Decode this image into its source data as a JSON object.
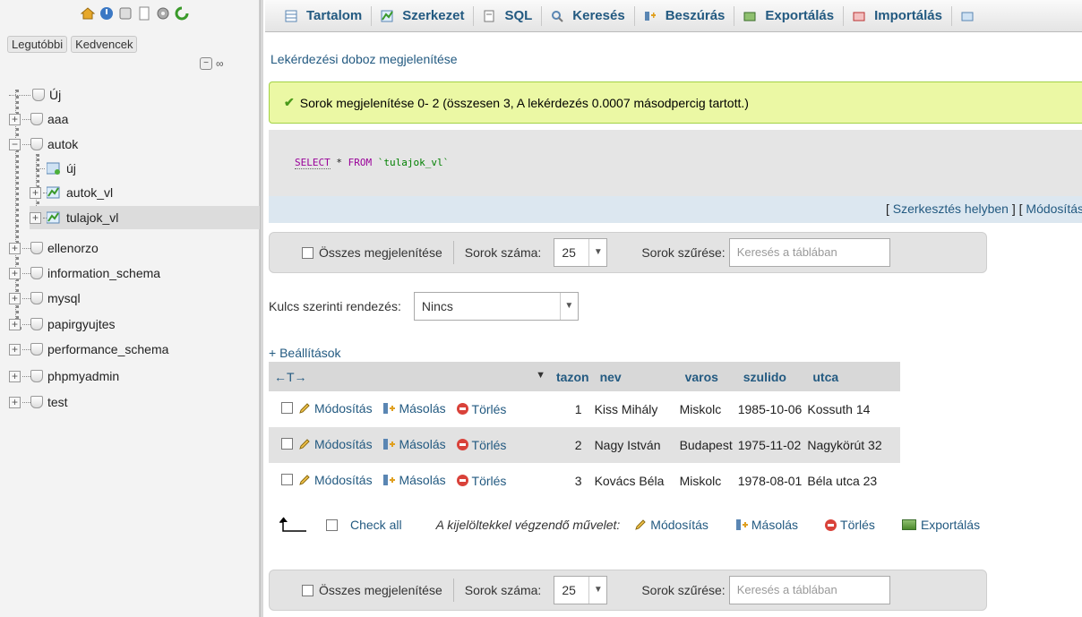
{
  "sidebar": {
    "tabs": [
      "Legutóbbi",
      "Kedvencek"
    ],
    "tree": [
      {
        "label": "Új",
        "kind": "new-db"
      },
      {
        "label": "aaa",
        "kind": "db"
      },
      {
        "label": "autok",
        "kind": "db-open"
      },
      {
        "label": "új",
        "kind": "new-table"
      },
      {
        "label": "autok_vl",
        "kind": "table"
      },
      {
        "label": "tulajok_vl",
        "kind": "table"
      },
      {
        "label": "ellenorzo",
        "kind": "db"
      },
      {
        "label": "information_schema",
        "kind": "db"
      },
      {
        "label": "mysql",
        "kind": "db"
      },
      {
        "label": "papirgyujtes",
        "kind": "db"
      },
      {
        "label": "performance_schema",
        "kind": "db"
      },
      {
        "label": "phpmyadmin",
        "kind": "db"
      },
      {
        "label": "test",
        "kind": "db"
      }
    ]
  },
  "topnav": {
    "tabs": [
      "Tartalom",
      "Szerkezet",
      "SQL",
      "Keresés",
      "Beszúrás",
      "Exportálás",
      "Importálás"
    ]
  },
  "query_box_link": "Lekérdezési doboz megjelenítése",
  "success_message": "Sorok megjelenítése 0- 2 (összesen 3, A lekérdezés 0.0007 másodpercig tartott.)",
  "sql": {
    "kw1": "SELECT",
    "star": " * ",
    "kw2": "FROM",
    "table": " `tulajok_vl`"
  },
  "edit_links": {
    "inline": "Szerkesztés helyben",
    "modify": "Módosítás"
  },
  "navbar": {
    "show_all": "Összes megjelenítése",
    "rows_label": "Sorok száma:",
    "rows_value": "25",
    "filter_label": "Sorok szűrése:",
    "filter_placeholder": "Keresés a táblában"
  },
  "sort": {
    "label": "Kulcs szerinti rendezés:",
    "value": "Nincs"
  },
  "options_link": "+ Beállítások",
  "table": {
    "arrows": "←T→",
    "columns": [
      "tazon",
      "nev",
      "varos",
      "szulido",
      "utca"
    ],
    "actions": {
      "edit": "Módosítás",
      "copy": "Másolás",
      "delete": "Törlés"
    },
    "rows": [
      [
        "1",
        "Kiss Mihály",
        "Miskolc",
        "1985-10-06",
        "Kossuth 14"
      ],
      [
        "2",
        "Nagy István",
        "Budapest",
        "1975-11-02",
        "Nagykörút 32"
      ],
      [
        "3",
        "Kovács Béla",
        "Miskolc",
        "1978-08-01",
        "Béla utca 23"
      ]
    ]
  },
  "bulk": {
    "check_all": "Check all",
    "label": "A kijelöltekkel végzendő művelet:",
    "edit": "Módosítás",
    "copy": "Másolás",
    "delete": "Törlés",
    "export": "Exportálás"
  },
  "colors": {
    "link": "#235a81",
    "success_bg": "#ebf8a4",
    "success_border": "#a2d246",
    "delete_red": "#d9423a"
  }
}
